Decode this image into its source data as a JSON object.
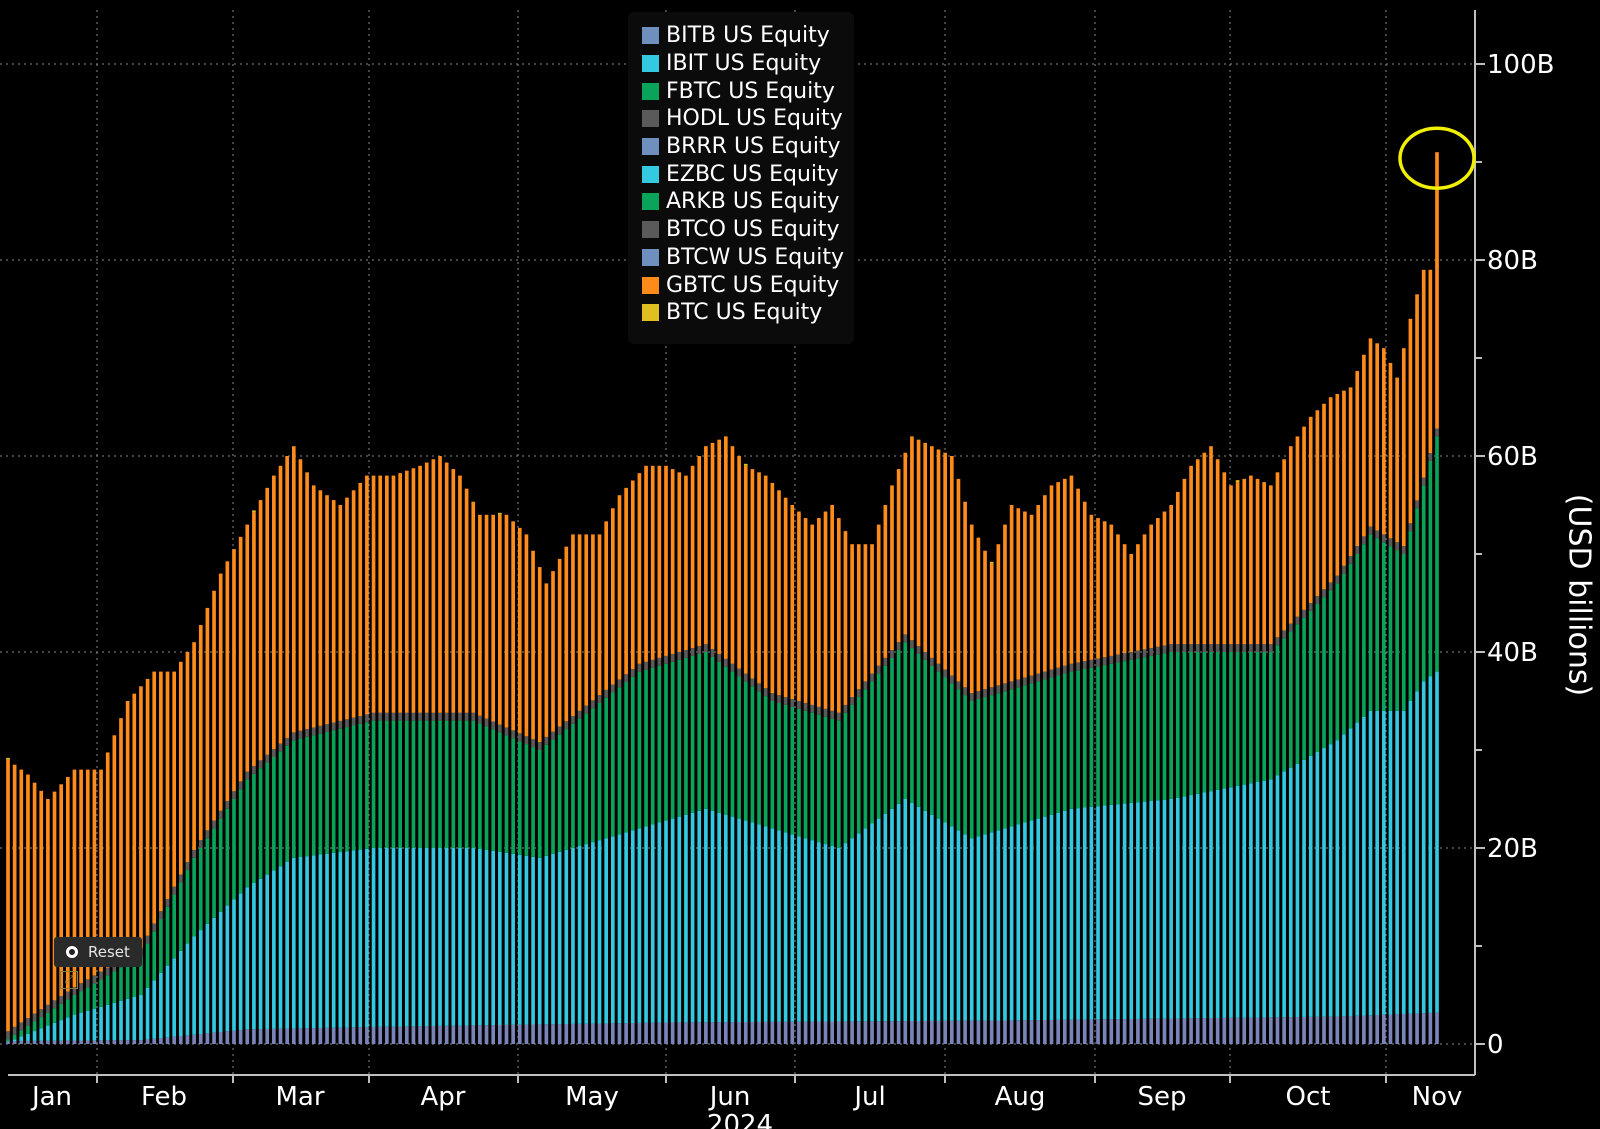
{
  "chart_data": {
    "type": "bar",
    "stacked": true,
    "ylabel": "(USD billions)",
    "xlabel": "2024",
    "ylim": [
      0,
      106
    ],
    "y_ticks": [
      {
        "value": 0,
        "label": "0"
      },
      {
        "value": 20,
        "label": "20B"
      },
      {
        "value": 40,
        "label": "40B"
      },
      {
        "value": 60,
        "label": "60B"
      },
      {
        "value": 80,
        "label": "80B"
      },
      {
        "value": 100,
        "label": "100B"
      }
    ],
    "month_labels": [
      "Jan",
      "Feb",
      "Mar",
      "Apr",
      "May",
      "Jun",
      "Jul",
      "Aug",
      "Sep",
      "Oct",
      "Nov"
    ],
    "grid": true,
    "legend_position": "top-center",
    "highlight": "yellow circle around the peak of the final bar",
    "series": [
      {
        "name": "BITB US Equity",
        "color": "#6f8fbf"
      },
      {
        "name": "IBIT US Equity",
        "color": "#33c9e0"
      },
      {
        "name": "FBTC US Equity",
        "color": "#0aa35a"
      },
      {
        "name": "HODL US Equity",
        "color": "#5a5a5a"
      },
      {
        "name": "BRRR US Equity",
        "color": "#6f8fbf"
      },
      {
        "name": "EZBC US Equity",
        "color": "#33c9e0"
      },
      {
        "name": "ARKB US Equity",
        "color": "#0aa35a"
      },
      {
        "name": "BTCO US Equity",
        "color": "#5a5a5a"
      },
      {
        "name": "BTCW US Equity",
        "color": "#6f8fbf"
      },
      {
        "name": "GBTC US Equity",
        "color": "#ff8c1a"
      },
      {
        "name": "BTC US Equity",
        "color": "#e0c020"
      }
    ],
    "stack_groups": [
      {
        "label": "BITB + BRRR + BTCW",
        "color": "#7a84b8"
      },
      {
        "label": "IBIT + EZBC",
        "color": "#33c9e0"
      },
      {
        "label": "FBTC + ARKB",
        "color": "#0aa35a"
      },
      {
        "label": "HODL + BTCO",
        "color": "#5a5a5a"
      },
      {
        "label": "GBTC",
        "color": "#ff8c1a"
      },
      {
        "label": "BTC",
        "color": "#e0c020"
      }
    ],
    "total_anchors": [
      [
        0,
        29
      ],
      [
        3,
        27.5
      ],
      [
        6,
        25
      ],
      [
        10,
        28
      ],
      [
        14,
        28
      ],
      [
        18,
        35
      ],
      [
        22,
        38
      ],
      [
        25,
        38
      ],
      [
        28,
        41
      ],
      [
        32,
        48
      ],
      [
        36,
        53
      ],
      [
        40,
        58
      ],
      [
        43,
        61
      ],
      [
        46,
        57
      ],
      [
        50,
        55
      ],
      [
        54,
        58
      ],
      [
        58,
        58
      ],
      [
        62,
        59
      ],
      [
        65,
        60
      ],
      [
        68,
        58
      ],
      [
        71,
        54
      ],
      [
        75,
        54
      ],
      [
        78,
        52
      ],
      [
        81,
        47
      ],
      [
        85,
        52
      ],
      [
        89,
        52
      ],
      [
        92,
        56
      ],
      [
        96,
        59
      ],
      [
        99,
        59
      ],
      [
        102,
        58
      ],
      [
        105,
        61
      ],
      [
        108,
        62
      ],
      [
        111,
        59
      ],
      [
        114,
        58
      ],
      [
        118,
        55
      ],
      [
        121,
        53
      ],
      [
        124,
        55
      ],
      [
        127,
        51
      ],
      [
        130,
        51
      ],
      [
        133,
        57
      ],
      [
        136,
        62
      ],
      [
        139,
        61
      ],
      [
        142,
        60
      ],
      [
        145,
        53
      ],
      [
        148,
        49
      ],
      [
        151,
        55
      ],
      [
        154,
        54
      ],
      [
        157,
        57
      ],
      [
        160,
        58
      ],
      [
        163,
        54
      ],
      [
        166,
        53
      ],
      [
        169,
        50
      ],
      [
        172,
        53
      ],
      [
        175,
        55
      ],
      [
        178,
        59
      ],
      [
        181,
        61
      ],
      [
        184,
        57
      ],
      [
        187,
        58
      ],
      [
        190,
        57
      ],
      [
        193,
        61
      ],
      [
        196,
        64
      ],
      [
        199,
        66
      ],
      [
        202,
        67
      ],
      [
        205,
        72
      ],
      [
        207,
        71
      ],
      [
        209,
        68
      ],
      [
        211,
        74
      ],
      [
        213,
        79
      ],
      [
        214,
        79
      ],
      [
        215,
        91
      ]
    ],
    "ibit_anchors": [
      [
        0,
        0.2
      ],
      [
        10,
        3
      ],
      [
        20,
        5
      ],
      [
        28,
        11
      ],
      [
        36,
        16
      ],
      [
        43,
        19
      ],
      [
        55,
        20
      ],
      [
        70,
        20
      ],
      [
        80,
        19
      ],
      [
        95,
        22
      ],
      [
        105,
        24
      ],
      [
        115,
        22
      ],
      [
        125,
        20
      ],
      [
        135,
        25
      ],
      [
        145,
        21
      ],
      [
        160,
        24
      ],
      [
        175,
        25
      ],
      [
        190,
        27
      ],
      [
        200,
        31
      ],
      [
        205,
        34
      ],
      [
        210,
        34
      ],
      [
        213,
        37
      ],
      [
        215,
        38
      ]
    ],
    "green_anchors": [
      [
        0,
        0.5
      ],
      [
        10,
        5
      ],
      [
        20,
        9
      ],
      [
        28,
        19
      ],
      [
        36,
        27
      ],
      [
        43,
        31
      ],
      [
        55,
        33
      ],
      [
        70,
        33
      ],
      [
        80,
        30
      ],
      [
        95,
        38
      ],
      [
        105,
        40
      ],
      [
        115,
        35
      ],
      [
        125,
        33
      ],
      [
        135,
        41
      ],
      [
        145,
        35
      ],
      [
        160,
        38
      ],
      [
        175,
        40
      ],
      [
        190,
        40
      ],
      [
        200,
        47
      ],
      [
        205,
        52
      ],
      [
        210,
        50
      ],
      [
        213,
        57
      ],
      [
        215,
        62
      ]
    ],
    "gray_anchors": [
      [
        0,
        0.3
      ],
      [
        20,
        0.4
      ],
      [
        36,
        1.5
      ],
      [
        60,
        1.8
      ],
      [
        100,
        2.2
      ],
      [
        150,
        2.4
      ],
      [
        200,
        2.8
      ],
      [
        215,
        3.2
      ]
    ]
  },
  "ui": {
    "reset_label": "Reset",
    "chart_tool_glyph": "⤢"
  }
}
